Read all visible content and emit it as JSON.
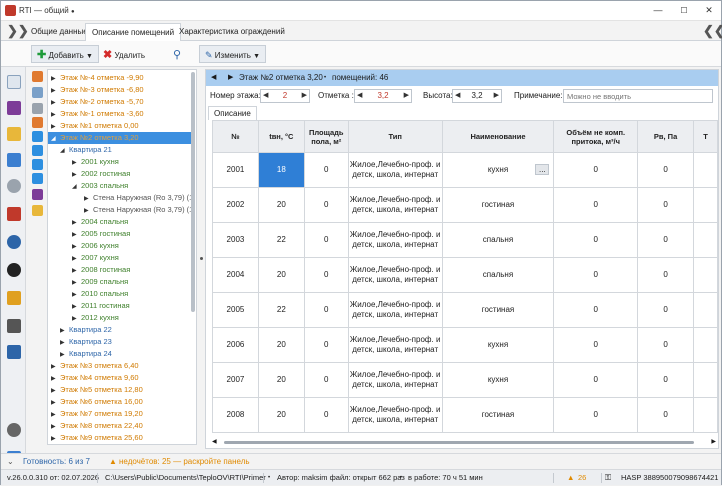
{
  "window": {
    "title": "RTI — общий",
    "modified_marker": "●"
  },
  "tabs": [
    "Общие данные",
    "Описание помещений",
    "Характеристика ограждений"
  ],
  "toolbar": {
    "add_label": "Добавить",
    "delete_label": "Удалить",
    "edit_label": "Изменить"
  },
  "tree": {
    "rows": [
      {
        "text": "Этаж №-4 отметка -9,90",
        "arrow": "▶"
      },
      {
        "text": "Этаж №-3 отметка -6,80",
        "arrow": "▶"
      },
      {
        "text": "Этаж №-2 отметка -5,70",
        "arrow": "▶"
      },
      {
        "text": "Этаж №-1 отметка -3,60",
        "arrow": "▶"
      },
      {
        "text": "Этаж №1 отметка 0,00",
        "arrow": "▶"
      },
      {
        "text": "Этаж №2 отметка 3,20",
        "arrow": "◢"
      },
      {
        "text": "Квартира 21",
        "arrow": "◢"
      },
      {
        "text": "2001 кухня",
        "arrow": "▶"
      },
      {
        "text": "2002 гостиная",
        "arrow": "▶"
      },
      {
        "text": "2003 спальня",
        "arrow": "◢"
      },
      {
        "text": "Стена Наружная (Ro 3,79) (1",
        "arrow": "▶"
      },
      {
        "text": "Стена Наружная (Ro 3,79) (1",
        "arrow": "▶"
      },
      {
        "text": "2004 спальня",
        "arrow": "▶"
      },
      {
        "text": "2005 гостиная",
        "arrow": "▶"
      },
      {
        "text": "2006 кухня",
        "arrow": "▶"
      },
      {
        "text": "2007 кухня",
        "arrow": "▶"
      },
      {
        "text": "2008 гостиная",
        "arrow": "▶"
      },
      {
        "text": "2009 спальня",
        "arrow": "▶"
      },
      {
        "text": "2010 спальня",
        "arrow": "▶"
      },
      {
        "text": "2011 гостиная",
        "arrow": "▶"
      },
      {
        "text": "2012 кухня",
        "arrow": "▶"
      },
      {
        "text": "Квартира 22",
        "arrow": "▶"
      },
      {
        "text": "Квартира 23",
        "arrow": "▶"
      },
      {
        "text": "Квартира 24",
        "arrow": "▶"
      },
      {
        "text": "Этаж №3 отметка 6,40",
        "arrow": "▶"
      },
      {
        "text": "Этаж №4 отметка 9,60",
        "arrow": "▶"
      },
      {
        "text": "Этаж №5 отметка 12,80",
        "arrow": "▶"
      },
      {
        "text": "Этаж №6 отметка 16,00",
        "arrow": "▶"
      },
      {
        "text": "Этаж №7 отметка 19,20",
        "arrow": "▶"
      },
      {
        "text": "Этаж №8 отметка 22,40",
        "arrow": "▶"
      },
      {
        "text": "Этаж №9 отметка 25,60",
        "arrow": "▶"
      }
    ]
  },
  "floor_header": {
    "title": "Этаж №2 отметка 3,20",
    "rooms_count": "помещений: 46"
  },
  "params": {
    "floor_num_label": "Номер этажа:",
    "floor_num_value": "2",
    "mark_label": "Отметка :",
    "mark_value": "3,2",
    "height_label": "Высота:",
    "height_value": "3,2",
    "note_label": "Примечание:",
    "note_placeholder": "Можно не вводить"
  },
  "subtab": "Описание",
  "table": {
    "headers": [
      "№",
      "tвн, °C",
      "Площадь пола, м²",
      "Тип",
      "Наименование",
      "Объём не комп. притока, м³/ч",
      "Pв, Па",
      "Т"
    ],
    "rows": [
      [
        "2001",
        "18",
        "0",
        "Жилое,Лечебно-проф. и детск, школа, интернат",
        "кухня",
        "0",
        "0",
        ""
      ],
      [
        "2002",
        "20",
        "0",
        "Жилое,Лечебно-проф. и детск, школа, интернат",
        "гостиная",
        "0",
        "0",
        ""
      ],
      [
        "2003",
        "22",
        "0",
        "Жилое,Лечебно-проф. и детск, школа, интернат",
        "спальня",
        "0",
        "0",
        ""
      ],
      [
        "2004",
        "20",
        "0",
        "Жилое,Лечебно-проф. и детск, школа, интернат",
        "спальня",
        "0",
        "0",
        ""
      ],
      [
        "2005",
        "22",
        "0",
        "Жилое,Лечебно-проф. и детск, школа, интернат",
        "гостиная",
        "0",
        "0",
        ""
      ],
      [
        "2006",
        "20",
        "0",
        "Жилое,Лечебно-проф. и детск, школа, интернат",
        "кухня",
        "0",
        "0",
        ""
      ],
      [
        "2007",
        "20",
        "0",
        "Жилое,Лечебно-проф. и детск, школа, интернат",
        "кухня",
        "0",
        "0",
        ""
      ],
      [
        "2008",
        "20",
        "0",
        "Жилое,Лечебно-проф. и детск, школа, интернат",
        "гостиная",
        "0",
        "0",
        ""
      ]
    ],
    "cell_button": "..."
  },
  "status1": {
    "ready": "Готовность: 6 из 7",
    "warning": "недочётов: 25 — раскройте панель"
  },
  "status2": {
    "version": "v.26.0.0.310 от: 02.07.2026",
    "path": "C:\\Users\\Public\\Documents\\TeploOV\\RTI\\Primer",
    "author": "Автор: maksim файл: открыт 662 раз",
    "work": "в работе: 70 ч 51 мин",
    "count": "26",
    "hasp": "HASP 388950079098674421"
  },
  "colors": {
    "accent": "#3c8fe0",
    "floor_bar": "#a9cdf0",
    "tree_floor": "#d07a00",
    "tree_room": "#3d7f2a",
    "tree_flat": "#2d65a8",
    "warn": "#e08a00"
  }
}
